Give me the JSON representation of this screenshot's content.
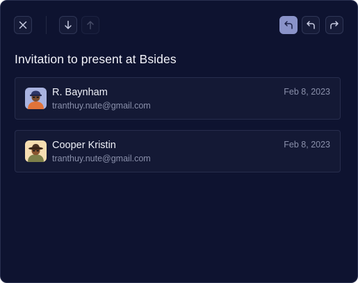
{
  "toolbar": {
    "left_icons": [
      "close-icon",
      "arrow-down-icon",
      "arrow-up-icon"
    ],
    "right_icons": [
      "reply-icon",
      "reply-icon",
      "forward-icon"
    ],
    "colors": {
      "panel": "#0e1330",
      "card": "#141935",
      "active": "#8a93c9"
    }
  },
  "thread": {
    "title": "Invitation to present at Bsides",
    "messages": [
      {
        "name": "R. Baynham",
        "email": "tranthuy.nute@gmail.com",
        "date": "Feb 8, 2023"
      },
      {
        "name": "Cooper Kristin",
        "email": "tranthuy.nute@gmail.com",
        "date": "Feb 8, 2023"
      }
    ]
  }
}
